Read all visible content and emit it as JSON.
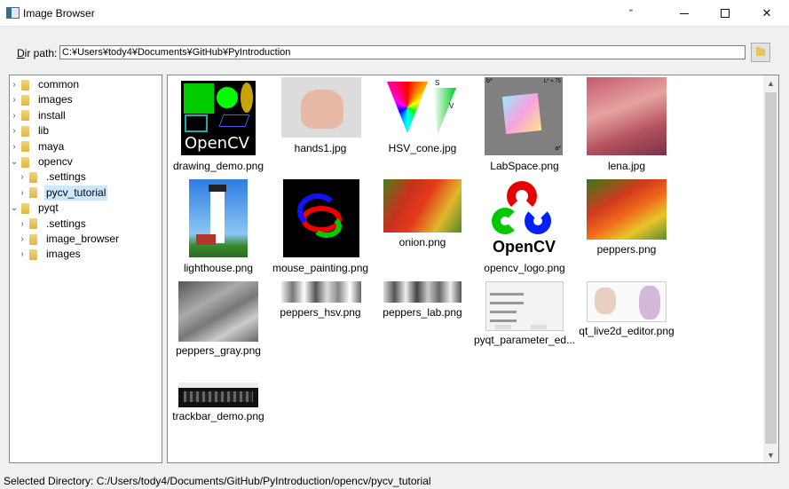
{
  "window": {
    "title": "Image Browser",
    "extra_glyph": "\"",
    "close_glyph": "✕"
  },
  "dir_path": {
    "label_accel": "D",
    "label_rest": "ir path:",
    "value": "C:¥Users¥tody4¥Documents¥GitHub¥PyIntroduction"
  },
  "tree": {
    "items": [
      {
        "label": "common",
        "depth": 0,
        "expanded": false
      },
      {
        "label": "images",
        "depth": 0,
        "expanded": false
      },
      {
        "label": "install",
        "depth": 0,
        "expanded": false
      },
      {
        "label": "lib",
        "depth": 0,
        "expanded": false
      },
      {
        "label": "maya",
        "depth": 0,
        "expanded": false
      },
      {
        "label": "opencv",
        "depth": 0,
        "expanded": true
      },
      {
        "label": ".settings",
        "depth": 1,
        "expanded": false
      },
      {
        "label": "pycv_tutorial",
        "depth": 1,
        "expanded": false,
        "selected": true
      },
      {
        "label": "pyqt",
        "depth": 0,
        "expanded": true
      },
      {
        "label": ".settings",
        "depth": 1,
        "expanded": false
      },
      {
        "label": "image_browser",
        "depth": 1,
        "expanded": false
      },
      {
        "label": "images",
        "depth": 1,
        "expanded": false
      }
    ]
  },
  "gallery": {
    "items": [
      {
        "name": "drawing_demo.png"
      },
      {
        "name": "hands1.jpg"
      },
      {
        "name": "HSV_cone.jpg"
      },
      {
        "name": "LabSpace.png"
      },
      {
        "name": "lena.jpg"
      },
      {
        "name": "lighthouse.png"
      },
      {
        "name": "mouse_painting.png"
      },
      {
        "name": "onion.png"
      },
      {
        "name": "opencv_logo.png"
      },
      {
        "name": "peppers.png"
      },
      {
        "name": "peppers_gray.png"
      },
      {
        "name": "peppers_hsv.png"
      },
      {
        "name": "peppers_lab.png"
      },
      {
        "name": "pyqt_parameter_ed..."
      },
      {
        "name": "qt_live2d_editor.png"
      },
      {
        "name": "trackbar_demo.png"
      }
    ],
    "image_text": {
      "opencv_word": "OpenCV",
      "labspace_b": "b*",
      "labspace_a": "a*",
      "labspace_l": "L* = 75",
      "hsv_s": "S",
      "hsv_v": "V"
    }
  },
  "status": {
    "text": "Selected Directory: C:/Users/tody4/Documents/GitHub/PyIntroduction/opencv/pycv_tutorial"
  }
}
